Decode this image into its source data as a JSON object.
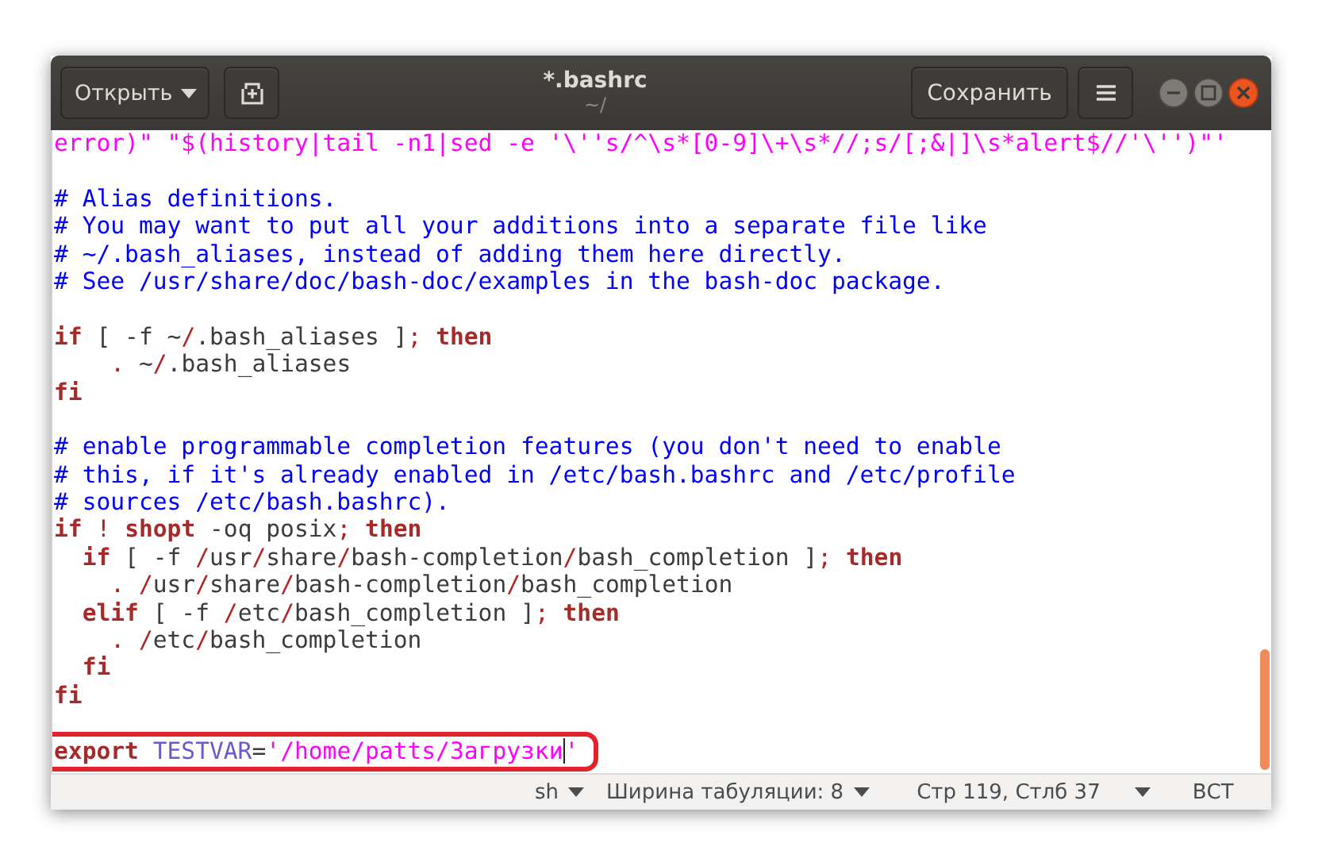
{
  "window": {
    "title": "*.bashrc",
    "subtitle": "~/"
  },
  "header": {
    "open_button": {
      "label": "Открыть"
    },
    "save_button": {
      "label": "Сохранить"
    }
  },
  "lines": [
    {
      "kind": "code",
      "segments": [
        {
          "kind": "string",
          "text": "error)\" \"$(history|tail -n1|sed -e '\\''s/^\\s*[0-9]\\+\\s*//;s/[;&|]\\s*alert$//'\\'')\"'"
        }
      ]
    },
    {
      "kind": "blank"
    },
    {
      "kind": "code",
      "segments": [
        {
          "kind": "comment",
          "text": "# Alias definitions."
        }
      ]
    },
    {
      "kind": "code",
      "segments": [
        {
          "kind": "comment",
          "text": "# You may want to put all your additions into a separate file like"
        }
      ]
    },
    {
      "kind": "code",
      "segments": [
        {
          "kind": "comment",
          "text": "# ~/.bash_aliases, instead of adding them here directly."
        }
      ]
    },
    {
      "kind": "code",
      "segments": [
        {
          "kind": "comment",
          "text": "# See /usr/share/doc/bash-doc/examples in the bash-doc package."
        }
      ]
    },
    {
      "kind": "blank"
    },
    {
      "kind": "code",
      "segments": [
        {
          "kind": "keyword",
          "text": "if"
        },
        {
          "kind": "plain",
          "text": " [ -f ~"
        },
        {
          "kind": "punct",
          "text": "/"
        },
        {
          "kind": "plain",
          "text": ".bash_aliases ]"
        },
        {
          "kind": "punct",
          "text": ";"
        },
        {
          "kind": "keyword",
          "text": " then"
        }
      ]
    },
    {
      "kind": "code",
      "segments": [
        {
          "kind": "punct",
          "text": "    ."
        },
        {
          "kind": "plain",
          "text": " ~"
        },
        {
          "kind": "punct",
          "text": "/"
        },
        {
          "kind": "plain",
          "text": ".bash_aliases"
        }
      ]
    },
    {
      "kind": "code",
      "segments": [
        {
          "kind": "keyword",
          "text": "fi"
        }
      ]
    },
    {
      "kind": "blank"
    },
    {
      "kind": "code",
      "segments": [
        {
          "kind": "comment",
          "text": "# enable programmable completion features (you don't need to enable"
        }
      ]
    },
    {
      "kind": "code",
      "segments": [
        {
          "kind": "comment",
          "text": "# this, if it's already enabled in /etc/bash.bashrc and /etc/profile"
        }
      ]
    },
    {
      "kind": "code",
      "segments": [
        {
          "kind": "comment",
          "text": "# sources /etc/bash.bashrc)."
        }
      ]
    },
    {
      "kind": "code",
      "segments": [
        {
          "kind": "keyword",
          "text": "if"
        },
        {
          "kind": "punct",
          "text": " ! "
        },
        {
          "kind": "keyword",
          "text": "shopt"
        },
        {
          "kind": "plain",
          "text": " -oq posix"
        },
        {
          "kind": "punct",
          "text": ";"
        },
        {
          "kind": "keyword",
          "text": " then"
        }
      ]
    },
    {
      "kind": "code",
      "segments": [
        {
          "kind": "keyword",
          "text": "  if"
        },
        {
          "kind": "plain",
          "text": " [ -f "
        },
        {
          "kind": "punct",
          "text": "/"
        },
        {
          "kind": "plain",
          "text": "usr"
        },
        {
          "kind": "punct",
          "text": "/"
        },
        {
          "kind": "plain",
          "text": "share"
        },
        {
          "kind": "punct",
          "text": "/"
        },
        {
          "kind": "plain",
          "text": "bash-completion"
        },
        {
          "kind": "punct",
          "text": "/"
        },
        {
          "kind": "plain",
          "text": "bash_completion ]"
        },
        {
          "kind": "punct",
          "text": ";"
        },
        {
          "kind": "keyword",
          "text": " then"
        }
      ]
    },
    {
      "kind": "code",
      "segments": [
        {
          "kind": "punct",
          "text": "    . /"
        },
        {
          "kind": "plain",
          "text": "usr"
        },
        {
          "kind": "punct",
          "text": "/"
        },
        {
          "kind": "plain",
          "text": "share"
        },
        {
          "kind": "punct",
          "text": "/"
        },
        {
          "kind": "plain",
          "text": "bash-completion"
        },
        {
          "kind": "punct",
          "text": "/"
        },
        {
          "kind": "plain",
          "text": "bash_completion"
        }
      ]
    },
    {
      "kind": "code",
      "segments": [
        {
          "kind": "keyword",
          "text": "  elif"
        },
        {
          "kind": "plain",
          "text": " [ -f "
        },
        {
          "kind": "punct",
          "text": "/"
        },
        {
          "kind": "plain",
          "text": "etc"
        },
        {
          "kind": "punct",
          "text": "/"
        },
        {
          "kind": "plain",
          "text": "bash_completion ]"
        },
        {
          "kind": "punct",
          "text": ";"
        },
        {
          "kind": "keyword",
          "text": " then"
        }
      ]
    },
    {
      "kind": "code",
      "segments": [
        {
          "kind": "punct",
          "text": "    . /"
        },
        {
          "kind": "plain",
          "text": "etc"
        },
        {
          "kind": "punct",
          "text": "/"
        },
        {
          "kind": "plain",
          "text": "bash_completion"
        }
      ]
    },
    {
      "kind": "code",
      "segments": [
        {
          "kind": "keyword",
          "text": "  fi"
        }
      ]
    },
    {
      "kind": "code",
      "segments": [
        {
          "kind": "keyword",
          "text": "fi"
        }
      ]
    },
    {
      "kind": "blank"
    },
    {
      "kind": "code",
      "highlighted": true,
      "segments": [
        {
          "kind": "keyword",
          "text": "export"
        },
        {
          "kind": "var",
          "text": " TESTVAR"
        },
        {
          "kind": "plain",
          "text": "="
        },
        {
          "kind": "string",
          "text": "'/home/patts/Загрузки",
          "cursor": true
        },
        {
          "kind": "string",
          "text": "'"
        }
      ]
    }
  ],
  "status_bar": {
    "language": "sh",
    "tab_width": "Ширина табуляции: 8",
    "position": "Стр 119, Стлб 37",
    "mode": "ВСТ"
  }
}
